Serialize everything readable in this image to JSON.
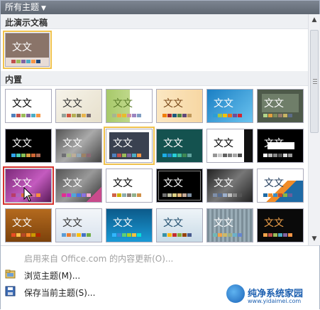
{
  "header": {
    "title": "所有主题",
    "dropdown_icon": "chevron-down-icon"
  },
  "sections": {
    "current": "此演示文稿",
    "builtin": "内置"
  },
  "thumb_text": "文文",
  "menu": {
    "items": [
      {
        "label": "启用来自 Office.com 的内容更新(O)...",
        "disabled": true
      },
      {
        "label": "浏览主题(M)...",
        "icon": "folder-icon",
        "disabled": false
      },
      {
        "label": "保存当前主题(S)...",
        "icon": "save-icon",
        "disabled": false
      }
    ]
  },
  "watermark": {
    "title": "纯净系统家园",
    "url": "www.yidaimei.com"
  },
  "colors": {
    "accent_selected": "#f0c24d",
    "accent_hover": "#d4332f",
    "header_bg": "#6d7580"
  }
}
